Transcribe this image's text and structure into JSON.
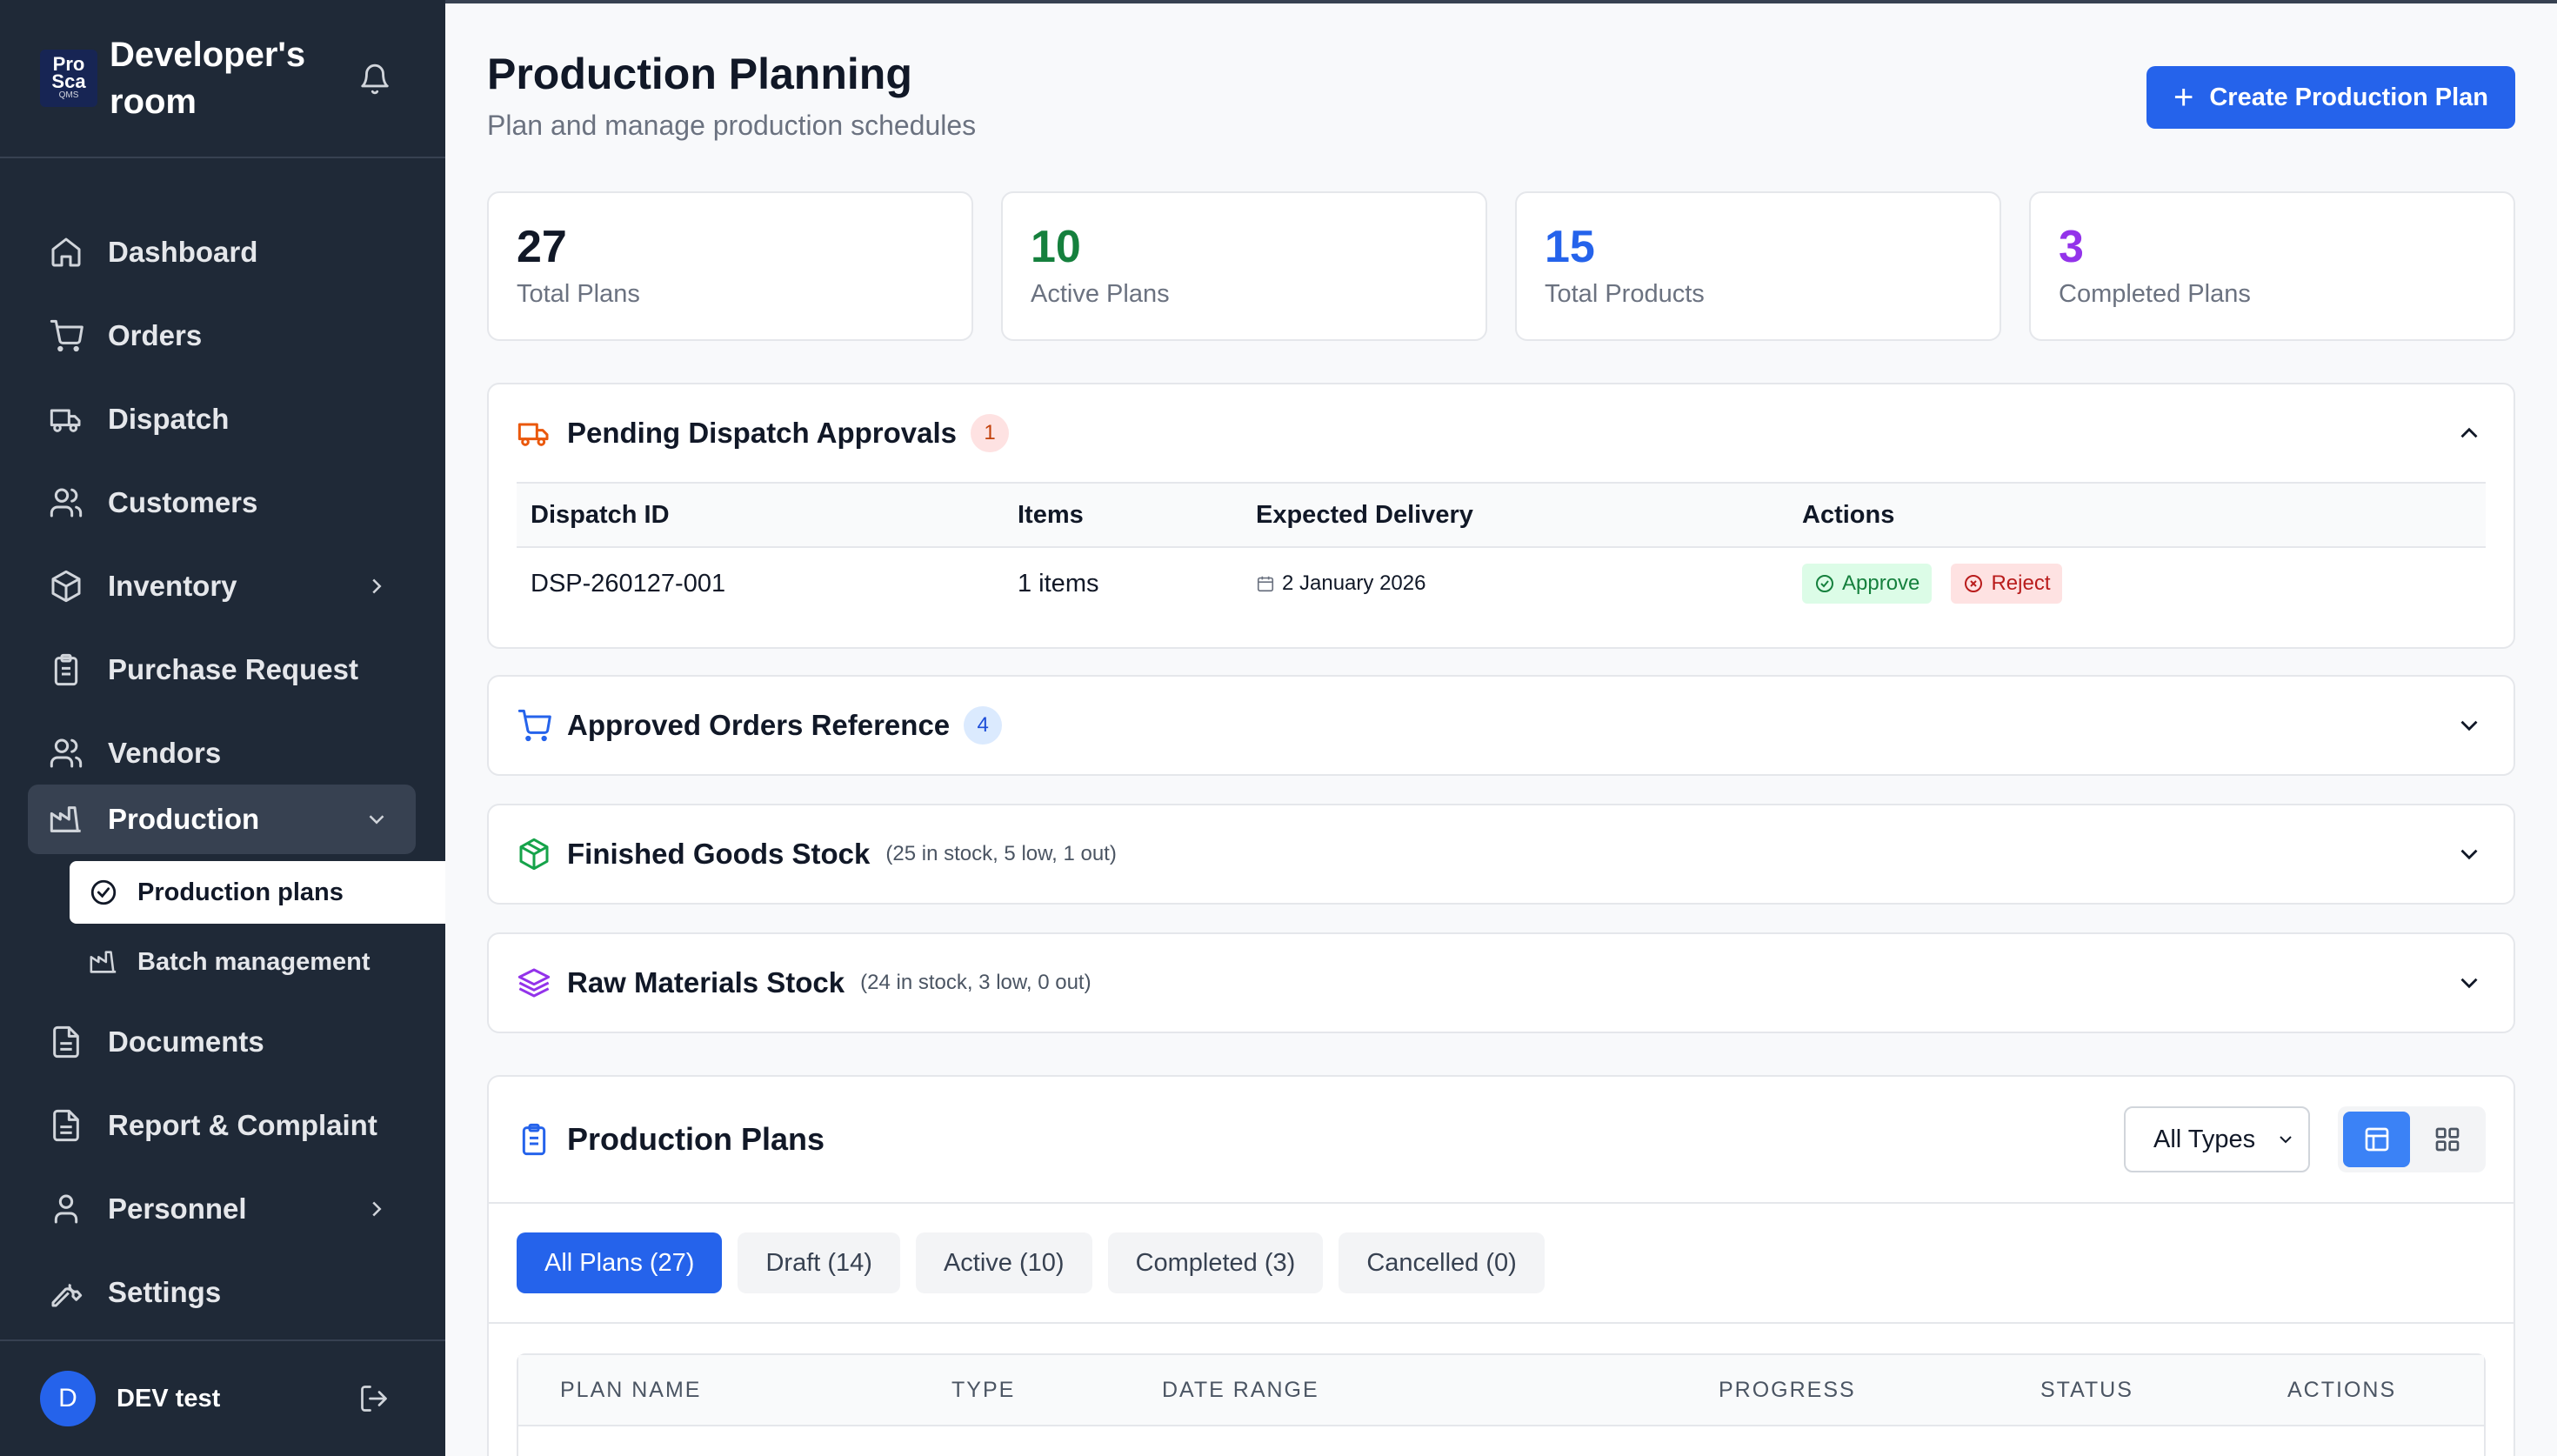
{
  "brand": {
    "name": "Developer's room",
    "logo_top": "Pro",
    "logo_mid": "Sca",
    "logo_small": "QMS"
  },
  "sidebar": {
    "items": [
      {
        "label": "Dashboard",
        "icon": "home-icon"
      },
      {
        "label": "Orders",
        "icon": "cart-icon"
      },
      {
        "label": "Dispatch",
        "icon": "truck-icon"
      },
      {
        "label": "Customers",
        "icon": "users-icon"
      },
      {
        "label": "Inventory",
        "icon": "box-icon"
      },
      {
        "label": "Purchase Request",
        "icon": "clipboard-icon"
      },
      {
        "label": "Vendors",
        "icon": "users-icon"
      },
      {
        "label": "Production",
        "icon": "factory-icon"
      },
      {
        "label": "Documents",
        "icon": "document-icon"
      },
      {
        "label": "Report & Complaint",
        "icon": "document-icon"
      },
      {
        "label": "Personnel",
        "icon": "user-icon"
      },
      {
        "label": "Settings",
        "icon": "wrench-icon"
      }
    ],
    "subitems": [
      {
        "label": "Production plans",
        "icon": "check-circle-icon"
      },
      {
        "label": "Batch management",
        "icon": "factory-icon"
      }
    ],
    "user": {
      "initial": "D",
      "name": "DEV test"
    }
  },
  "header": {
    "title": "Production Planning",
    "subtitle": "Plan and manage production schedules",
    "create_label": "Create Production Plan"
  },
  "stats": [
    {
      "value": "27",
      "label": "Total Plans",
      "color": "#111827"
    },
    {
      "value": "10",
      "label": "Active Plans",
      "color": "#15803d"
    },
    {
      "value": "15",
      "label": "Total Products",
      "color": "#2563eb"
    },
    {
      "value": "3",
      "label": "Completed Plans",
      "color": "#9333ea"
    }
  ],
  "pending": {
    "title": "Pending Dispatch Approvals",
    "count": "1",
    "columns": [
      "Dispatch ID",
      "Items",
      "Expected Delivery",
      "Actions"
    ],
    "rows": [
      {
        "id": "DSP-260127-001",
        "items": "1 items",
        "delivery": "2 January 2026",
        "approve": "Approve",
        "reject": "Reject"
      }
    ]
  },
  "approved": {
    "title": "Approved Orders Reference",
    "count": "4"
  },
  "finished": {
    "title": "Finished Goods Stock",
    "note": "(25 in stock, 5 low, 1 out)"
  },
  "raw": {
    "title": "Raw Materials Stock",
    "note": "(24 in stock, 3 low, 0 out)"
  },
  "plans": {
    "title": "Production Plans",
    "filter_value": "All Types",
    "tabs": [
      "All Plans (27)",
      "Draft (14)",
      "Active (10)",
      "Completed (3)",
      "Cancelled (0)"
    ],
    "columns": [
      "PLAN NAME",
      "TYPE",
      "DATE RANGE",
      "PROGRESS",
      "STATUS",
      "ACTIONS"
    ]
  }
}
